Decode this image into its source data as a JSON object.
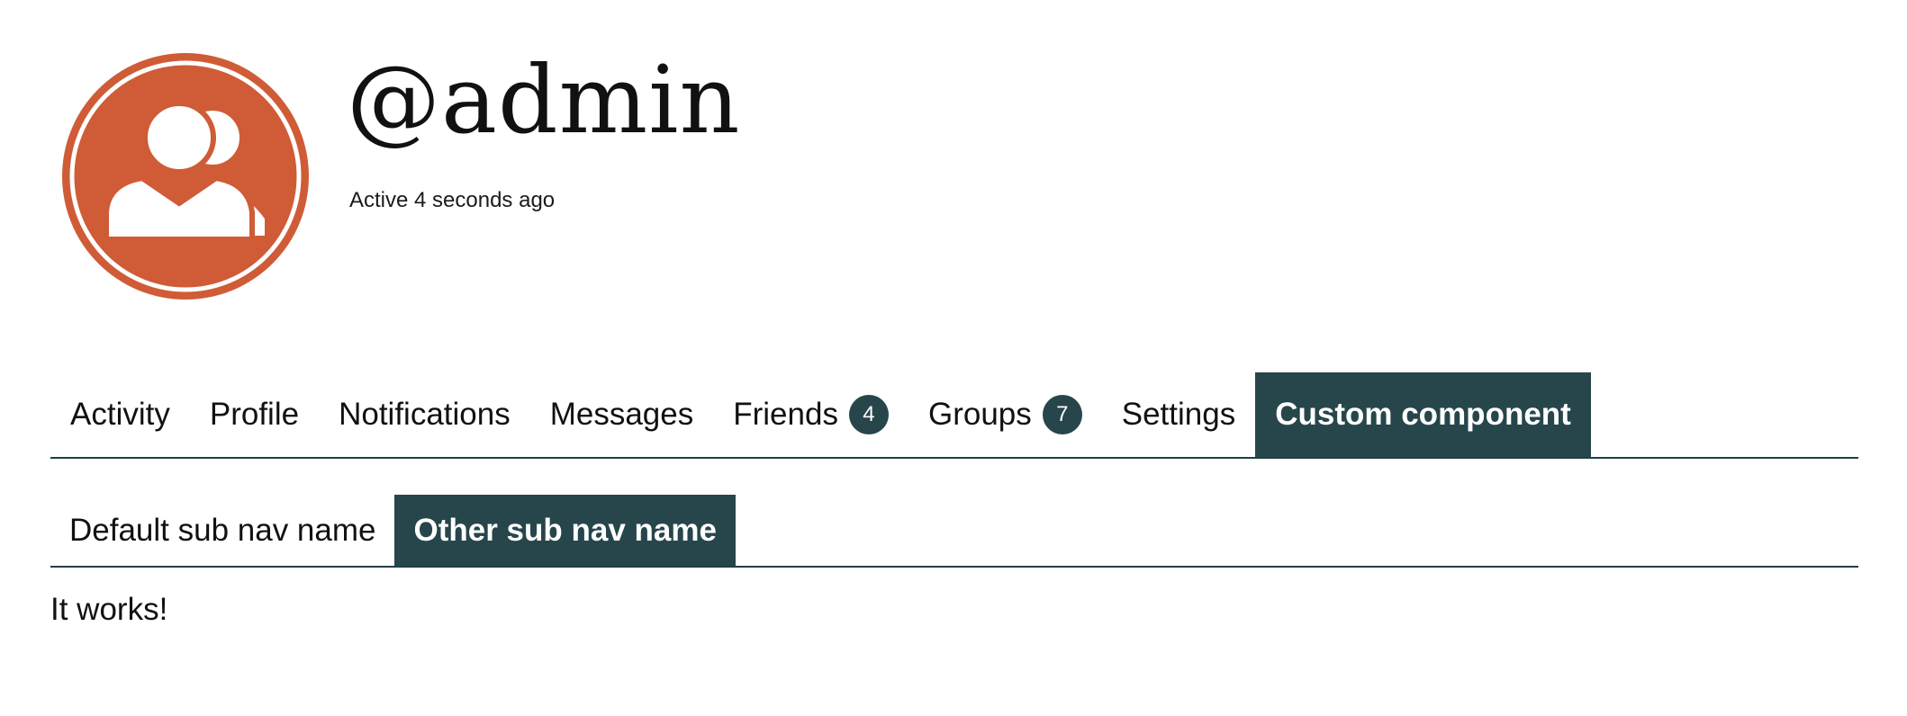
{
  "profile": {
    "username": "@admin",
    "last_active": "Active 4 seconds ago",
    "avatar_icon": "user-group-avatar-icon",
    "avatar_color": "#cf5c36"
  },
  "primary_nav": {
    "items": [
      {
        "label": "Activity"
      },
      {
        "label": "Profile"
      },
      {
        "label": "Notifications"
      },
      {
        "label": "Messages"
      },
      {
        "label": "Friends",
        "count": "4"
      },
      {
        "label": "Groups",
        "count": "7"
      },
      {
        "label": "Settings"
      },
      {
        "label": "Custom component",
        "selected": true
      }
    ],
    "accent_color": "#26464b"
  },
  "sub_nav": {
    "items": [
      {
        "label": "Default sub nav name"
      },
      {
        "label": "Other sub nav name",
        "selected": true
      }
    ]
  },
  "content": {
    "text": "It works!"
  }
}
